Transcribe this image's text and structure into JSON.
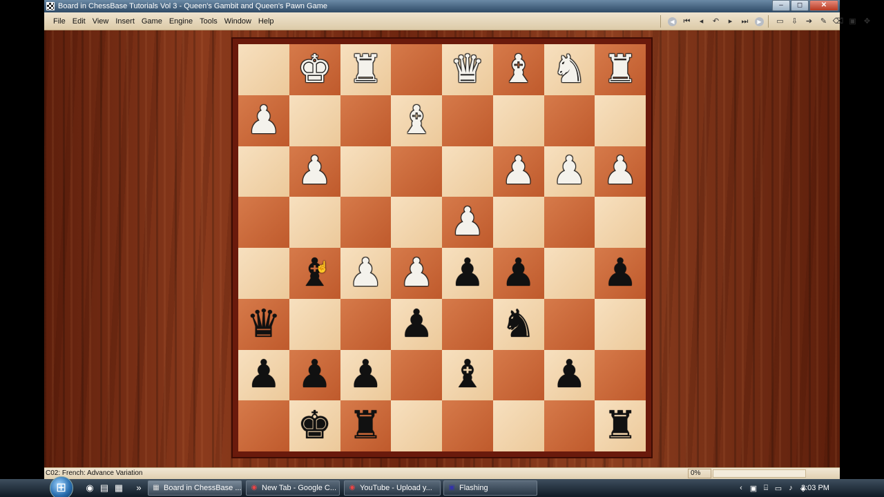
{
  "window": {
    "title": "Board in ChessBase Tutorials Vol 3 - Queen's Gambit and Queen's Pawn Game",
    "controls": {
      "minimize": "‒",
      "maximize": "◻",
      "close": "✕"
    }
  },
  "menu": [
    "File",
    "Edit",
    "View",
    "Insert",
    "Game",
    "Engine",
    "Tools",
    "Window",
    "Help"
  ],
  "toolbar": {
    "nav": [
      {
        "name": "back-icon",
        "glyph": "◀"
      },
      {
        "name": "first-move-icon",
        "glyph": "⏮"
      },
      {
        "name": "previous-move-icon",
        "glyph": "◂"
      },
      {
        "name": "take-back-icon",
        "glyph": "↶"
      },
      {
        "name": "next-move-icon",
        "glyph": "▸"
      },
      {
        "name": "last-move-icon",
        "glyph": "⏭"
      },
      {
        "name": "forward-icon",
        "glyph": "▶"
      }
    ],
    "tools": [
      {
        "name": "new-document-icon",
        "glyph": "▭"
      },
      {
        "name": "download-icon",
        "glyph": "⇩"
      },
      {
        "name": "arrow-right-icon",
        "glyph": "➔"
      },
      {
        "name": "pen-icon",
        "glyph": "✎"
      },
      {
        "name": "eraser-icon",
        "glyph": "⌫"
      },
      {
        "name": "pdf-icon",
        "glyph": "▣"
      },
      {
        "name": "flip-board-icon",
        "glyph": "✥"
      }
    ]
  },
  "board": {
    "ranks": [
      [
        "",
        "wK",
        "wR",
        "",
        "wQ",
        "wB",
        "wN",
        "wR"
      ],
      [
        "wP",
        "",
        "",
        "wB",
        "",
        "",
        "",
        ""
      ],
      [
        "",
        "wP",
        "",
        "",
        "",
        "wP",
        "wP",
        "wP"
      ],
      [
        "",
        "",
        "",
        "",
        "wP",
        "",
        "",
        ""
      ],
      [
        "",
        "bB",
        "wP",
        "wP",
        "bP",
        "bP",
        "",
        "bP"
      ],
      [
        "bQ",
        "",
        "",
        "bP",
        "",
        "bN",
        "",
        ""
      ],
      [
        "bP",
        "bP",
        "bP",
        "",
        "bB",
        "",
        "bP",
        ""
      ],
      [
        "",
        "bK",
        "bR",
        "",
        "",
        "",
        "",
        "bR"
      ]
    ],
    "glyphs": {
      "K": "♚",
      "Q": "♛",
      "R": "♜",
      "B": "♝",
      "N": "♞",
      "P": "♟"
    }
  },
  "status": {
    "opening": "C02: French: Advance Variation",
    "progress_label": "0%",
    "progress": 0.0
  },
  "taskbar": {
    "quick_launch": [
      {
        "name": "chrome-icon",
        "glyph": "◉"
      },
      {
        "name": "desktop-icon",
        "glyph": "▤"
      },
      {
        "name": "window-switch-icon",
        "glyph": "▦"
      },
      {
        "name": "more-icon",
        "glyph": "»"
      }
    ],
    "tasks": [
      {
        "label": "Board in ChessBase ...",
        "icon": "▦",
        "name": "chessbase-task-icon"
      },
      {
        "label": "New Tab - Google C...",
        "icon": "◉",
        "name": "chrome-task-icon"
      },
      {
        "label": "YouTube - Upload y...",
        "icon": "◉",
        "name": "chrome-task-icon"
      },
      {
        "label": "Flashing",
        "icon": "▣",
        "name": "flashing-task-icon"
      }
    ],
    "tray": [
      {
        "name": "tray-arrow-icon",
        "glyph": "‹"
      },
      {
        "name": "tray-app-icon",
        "glyph": "▣"
      },
      {
        "name": "tray-network-icon",
        "glyph": "⌸"
      },
      {
        "name": "tray-monitor-icon",
        "glyph": "▭"
      },
      {
        "name": "tray-volume-icon",
        "glyph": "♪"
      },
      {
        "name": "tray-security-icon",
        "glyph": "◈"
      }
    ],
    "clock": "2:03 PM"
  }
}
